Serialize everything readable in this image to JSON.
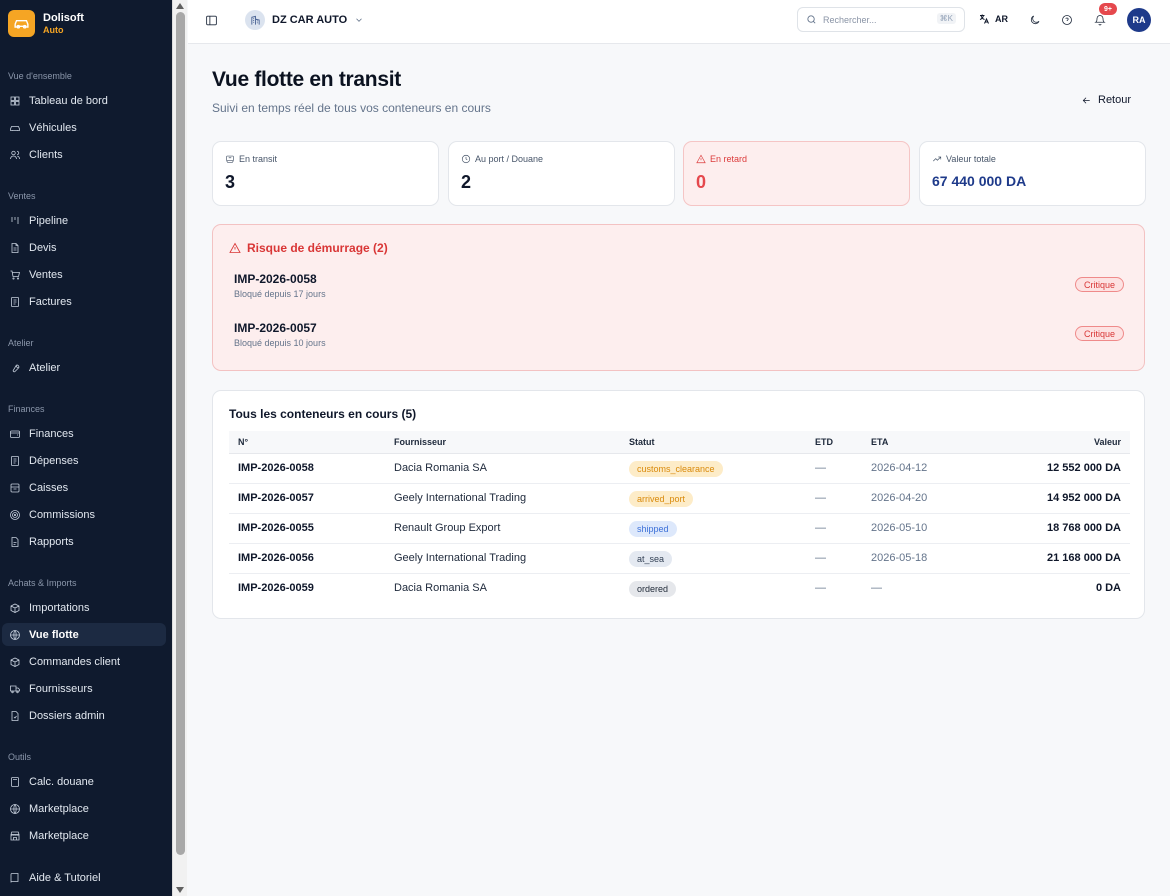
{
  "brand": {
    "name": "Dolisoft",
    "sub": "Auto",
    "accent": "#f5a524"
  },
  "sidebar": {
    "sections": [
      {
        "label": "Vue d'ensemble",
        "items": [
          {
            "label": "Tableau de bord",
            "icon": "grid-icon"
          },
          {
            "label": "Véhicules",
            "icon": "car-icon"
          },
          {
            "label": "Clients",
            "icon": "users-icon"
          }
        ]
      },
      {
        "label": "Ventes",
        "items": [
          {
            "label": "Pipeline",
            "icon": "kanban-icon"
          },
          {
            "label": "Devis",
            "icon": "file-icon"
          },
          {
            "label": "Ventes",
            "icon": "cart-icon"
          },
          {
            "label": "Factures",
            "icon": "receipt-icon"
          }
        ]
      },
      {
        "label": "Atelier",
        "items": [
          {
            "label": "Atelier",
            "icon": "wrench-icon"
          }
        ]
      },
      {
        "label": "Finances",
        "items": [
          {
            "label": "Finances",
            "icon": "wallet-icon"
          },
          {
            "label": "Dépenses",
            "icon": "receipt-icon"
          },
          {
            "label": "Caisses",
            "icon": "cash-register-icon"
          },
          {
            "label": "Commissions",
            "icon": "target-icon"
          },
          {
            "label": "Rapports",
            "icon": "report-icon"
          }
        ]
      },
      {
        "label": "Achats & Imports",
        "items": [
          {
            "label": "Importations",
            "icon": "package-icon"
          },
          {
            "label": "Vue flotte",
            "icon": "globe-icon",
            "active": true
          },
          {
            "label": "Commandes client",
            "icon": "box-icon"
          },
          {
            "label": "Fournisseurs",
            "icon": "truck-icon"
          },
          {
            "label": "Dossiers admin",
            "icon": "folder-icon"
          }
        ]
      },
      {
        "label": "Outils",
        "items": [
          {
            "label": "Calc. douane",
            "icon": "calculator-icon"
          },
          {
            "label": "Marketplace",
            "icon": "globe-icon"
          },
          {
            "label": "Marketplace",
            "icon": "store-icon"
          }
        ]
      }
    ],
    "footer": {
      "label": "Aide & Tutoriel",
      "icon": "book-icon"
    }
  },
  "topbar": {
    "company": "DZ CAR AUTO",
    "search_placeholder": "Rechercher...",
    "search_shortcut": "⌘K",
    "language": "AR",
    "notif_count": "9+",
    "user_initials": "RA"
  },
  "page": {
    "title": "Vue flotte en transit",
    "subtitle": "Suivi en temps réel de tous vos conteneurs en cours",
    "back_label": "Retour"
  },
  "stats": [
    {
      "label": "En transit",
      "value": "3",
      "icon": "ship-icon"
    },
    {
      "label": "Au port / Douane",
      "value": "2",
      "icon": "clock-icon"
    },
    {
      "label": "En retard",
      "value": "0",
      "icon": "alert-icon",
      "danger": true
    },
    {
      "label": "Valeur totale",
      "value": "67 440 000 DA",
      "icon": "trending-up-icon",
      "money": true
    }
  ],
  "risk": {
    "title": "Risque de démurrage (2)",
    "items": [
      {
        "id": "IMP-2026-0058",
        "desc": "Bloqué depuis 17 jours",
        "badge": "Critique"
      },
      {
        "id": "IMP-2026-0057",
        "desc": "Bloqué depuis 10 jours",
        "badge": "Critique"
      }
    ]
  },
  "table": {
    "title": "Tous les conteneurs en cours (5)",
    "headers": {
      "num": "N°",
      "supplier": "Fournisseur",
      "status": "Statut",
      "etd": "ETD",
      "eta": "ETA",
      "value": "Valeur"
    },
    "rows": [
      {
        "num": "IMP-2026-0058",
        "supplier": "Dacia Romania SA",
        "status": "customs_clearance",
        "etd": "—",
        "eta": "2026-04-12",
        "value": "12 552 000 DA"
      },
      {
        "num": "IMP-2026-0057",
        "supplier": "Geely International Trading",
        "status": "arrived_port",
        "etd": "—",
        "eta": "2026-04-20",
        "value": "14 952 000 DA"
      },
      {
        "num": "IMP-2026-0055",
        "supplier": "Renault Group Export",
        "status": "shipped",
        "etd": "—",
        "eta": "2026-05-10",
        "value": "18 768 000 DA"
      },
      {
        "num": "IMP-2026-0056",
        "supplier": "Geely International Trading",
        "status": "at_sea",
        "etd": "—",
        "eta": "2026-05-18",
        "value": "21 168 000 DA"
      },
      {
        "num": "IMP-2026-0059",
        "supplier": "Dacia Romania SA",
        "status": "ordered",
        "etd": "—",
        "eta": "—",
        "value": "0 DA"
      }
    ]
  },
  "status_colors": {
    "customs_clearance": {
      "bg": "#fdecc8",
      "fg": "#d98a0b"
    },
    "arrived_port": {
      "bg": "#fdecc8",
      "fg": "#d98a0b"
    },
    "shipped": {
      "bg": "#dde8fb",
      "fg": "#3b6fd8"
    },
    "at_sea": {
      "bg": "#e4e9f1",
      "fg": "#334155"
    },
    "ordered": {
      "bg": "#e5e7eb",
      "fg": "#1f2937"
    }
  }
}
